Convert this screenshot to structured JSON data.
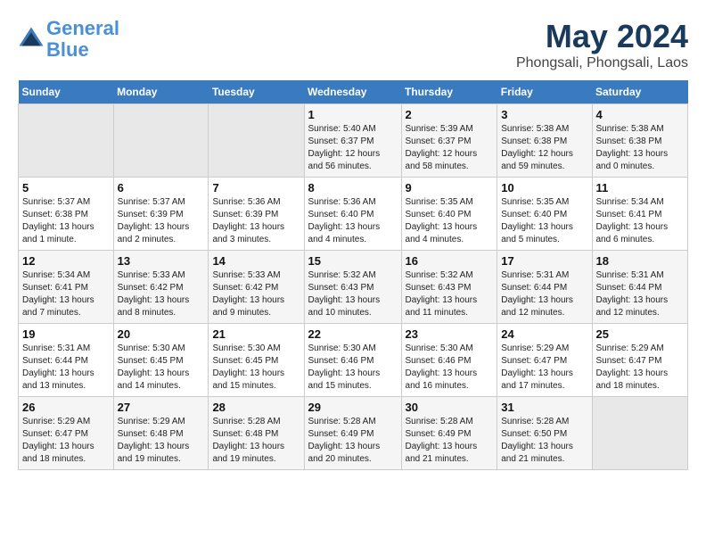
{
  "header": {
    "logo_line1": "General",
    "logo_line2": "Blue",
    "title": "May 2024",
    "subtitle": "Phongsali, Phongsali, Laos"
  },
  "weekdays": [
    "Sunday",
    "Monday",
    "Tuesday",
    "Wednesday",
    "Thursday",
    "Friday",
    "Saturday"
  ],
  "weeks": [
    [
      {
        "day": "",
        "info": ""
      },
      {
        "day": "",
        "info": ""
      },
      {
        "day": "",
        "info": ""
      },
      {
        "day": "1",
        "info": "Sunrise: 5:40 AM\nSunset: 6:37 PM\nDaylight: 12 hours\nand 56 minutes."
      },
      {
        "day": "2",
        "info": "Sunrise: 5:39 AM\nSunset: 6:37 PM\nDaylight: 12 hours\nand 58 minutes."
      },
      {
        "day": "3",
        "info": "Sunrise: 5:38 AM\nSunset: 6:38 PM\nDaylight: 12 hours\nand 59 minutes."
      },
      {
        "day": "4",
        "info": "Sunrise: 5:38 AM\nSunset: 6:38 PM\nDaylight: 13 hours\nand 0 minutes."
      }
    ],
    [
      {
        "day": "5",
        "info": "Sunrise: 5:37 AM\nSunset: 6:38 PM\nDaylight: 13 hours\nand 1 minute."
      },
      {
        "day": "6",
        "info": "Sunrise: 5:37 AM\nSunset: 6:39 PM\nDaylight: 13 hours\nand 2 minutes."
      },
      {
        "day": "7",
        "info": "Sunrise: 5:36 AM\nSunset: 6:39 PM\nDaylight: 13 hours\nand 3 minutes."
      },
      {
        "day": "8",
        "info": "Sunrise: 5:36 AM\nSunset: 6:40 PM\nDaylight: 13 hours\nand 4 minutes."
      },
      {
        "day": "9",
        "info": "Sunrise: 5:35 AM\nSunset: 6:40 PM\nDaylight: 13 hours\nand 4 minutes."
      },
      {
        "day": "10",
        "info": "Sunrise: 5:35 AM\nSunset: 6:40 PM\nDaylight: 13 hours\nand 5 minutes."
      },
      {
        "day": "11",
        "info": "Sunrise: 5:34 AM\nSunset: 6:41 PM\nDaylight: 13 hours\nand 6 minutes."
      }
    ],
    [
      {
        "day": "12",
        "info": "Sunrise: 5:34 AM\nSunset: 6:41 PM\nDaylight: 13 hours\nand 7 minutes."
      },
      {
        "day": "13",
        "info": "Sunrise: 5:33 AM\nSunset: 6:42 PM\nDaylight: 13 hours\nand 8 minutes."
      },
      {
        "day": "14",
        "info": "Sunrise: 5:33 AM\nSunset: 6:42 PM\nDaylight: 13 hours\nand 9 minutes."
      },
      {
        "day": "15",
        "info": "Sunrise: 5:32 AM\nSunset: 6:43 PM\nDaylight: 13 hours\nand 10 minutes."
      },
      {
        "day": "16",
        "info": "Sunrise: 5:32 AM\nSunset: 6:43 PM\nDaylight: 13 hours\nand 11 minutes."
      },
      {
        "day": "17",
        "info": "Sunrise: 5:31 AM\nSunset: 6:44 PM\nDaylight: 13 hours\nand 12 minutes."
      },
      {
        "day": "18",
        "info": "Sunrise: 5:31 AM\nSunset: 6:44 PM\nDaylight: 13 hours\nand 12 minutes."
      }
    ],
    [
      {
        "day": "19",
        "info": "Sunrise: 5:31 AM\nSunset: 6:44 PM\nDaylight: 13 hours\nand 13 minutes."
      },
      {
        "day": "20",
        "info": "Sunrise: 5:30 AM\nSunset: 6:45 PM\nDaylight: 13 hours\nand 14 minutes."
      },
      {
        "day": "21",
        "info": "Sunrise: 5:30 AM\nSunset: 6:45 PM\nDaylight: 13 hours\nand 15 minutes."
      },
      {
        "day": "22",
        "info": "Sunrise: 5:30 AM\nSunset: 6:46 PM\nDaylight: 13 hours\nand 15 minutes."
      },
      {
        "day": "23",
        "info": "Sunrise: 5:30 AM\nSunset: 6:46 PM\nDaylight: 13 hours\nand 16 minutes."
      },
      {
        "day": "24",
        "info": "Sunrise: 5:29 AM\nSunset: 6:47 PM\nDaylight: 13 hours\nand 17 minutes."
      },
      {
        "day": "25",
        "info": "Sunrise: 5:29 AM\nSunset: 6:47 PM\nDaylight: 13 hours\nand 18 minutes."
      }
    ],
    [
      {
        "day": "26",
        "info": "Sunrise: 5:29 AM\nSunset: 6:47 PM\nDaylight: 13 hours\nand 18 minutes."
      },
      {
        "day": "27",
        "info": "Sunrise: 5:29 AM\nSunset: 6:48 PM\nDaylight: 13 hours\nand 19 minutes."
      },
      {
        "day": "28",
        "info": "Sunrise: 5:28 AM\nSunset: 6:48 PM\nDaylight: 13 hours\nand 19 minutes."
      },
      {
        "day": "29",
        "info": "Sunrise: 5:28 AM\nSunset: 6:49 PM\nDaylight: 13 hours\nand 20 minutes."
      },
      {
        "day": "30",
        "info": "Sunrise: 5:28 AM\nSunset: 6:49 PM\nDaylight: 13 hours\nand 21 minutes."
      },
      {
        "day": "31",
        "info": "Sunrise: 5:28 AM\nSunset: 6:50 PM\nDaylight: 13 hours\nand 21 minutes."
      },
      {
        "day": "",
        "info": ""
      }
    ]
  ]
}
